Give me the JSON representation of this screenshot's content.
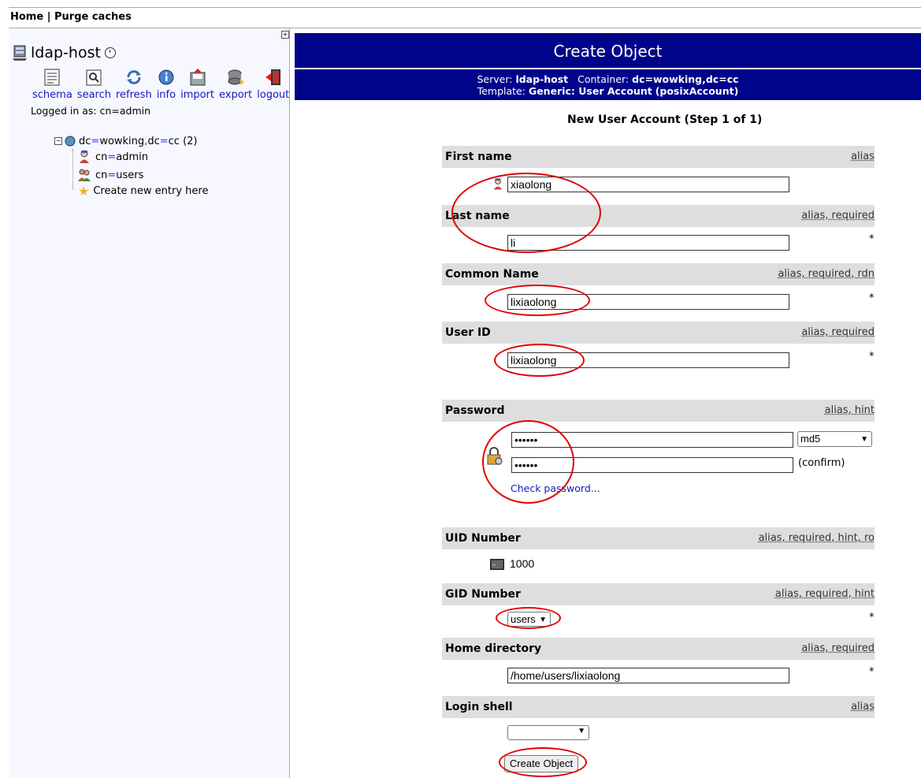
{
  "nav": {
    "home": "Home",
    "separator": "|",
    "purge": "Purge caches"
  },
  "server": {
    "name": "ldap-host"
  },
  "toolbar": [
    "schema",
    "search",
    "refresh",
    "info",
    "import",
    "export",
    "logout"
  ],
  "logged_in": {
    "label": "Logged in as:",
    "cn": "cn",
    "eq": "=",
    "value": "admin"
  },
  "tree": {
    "root": {
      "dc1": "dc",
      "eq": "=",
      "v1": "wowking",
      "comma": ",",
      "dc2": "dc",
      "v2": "cc",
      "count": "(2)"
    },
    "children": [
      {
        "key": "cn",
        "value": "admin"
      },
      {
        "key": "cn",
        "value": "users"
      }
    ],
    "create": "Create new entry here"
  },
  "banner": {
    "title": "Create Object",
    "server_label": "Server:",
    "server_value": "ldap-host",
    "container_label": "Container:",
    "container_value": "dc=wowking,dc=cc",
    "template_label": "Template:",
    "template_value": "Generic: User Account",
    "template_class": "(posixAccount)"
  },
  "step_title": "New User Account (Step 1 of 1)",
  "fields": {
    "first_name": {
      "label": "First name",
      "hints": "alias",
      "value": "xiaolong"
    },
    "last_name": {
      "label": "Last name",
      "hints": "alias, required",
      "value": "li",
      "required": "*"
    },
    "common_name": {
      "label": "Common Name",
      "hints": "alias, required, rdn",
      "value": "lixiaolong",
      "required": "*"
    },
    "user_id": {
      "label": "User ID",
      "hints": "alias, required",
      "value": "lixiaolong",
      "required": "*"
    },
    "password": {
      "label": "Password",
      "hints": "alias, hint",
      "value": "••••••",
      "confirm_value": "••••••",
      "hash": "md5",
      "confirm_label": "(confirm)",
      "check_link": "Check password..."
    },
    "uid_number": {
      "label": "UID Number",
      "hints": "alias, required, hint, ro",
      "value": "1000"
    },
    "gid_number": {
      "label": "GID Number",
      "hints": "alias, required, hint",
      "value": "users",
      "required": "*"
    },
    "home_dir": {
      "label": "Home directory",
      "hints": "alias, required",
      "value": "/home/users/lixiaolong",
      "required": "*"
    },
    "login_shell": {
      "label": "Login shell",
      "hints": "alias",
      "value": ""
    }
  },
  "submit": "Create Object",
  "colors": {
    "banner": "#00048a",
    "link": "#1515c0",
    "annotation": "#e00000",
    "header_bg": "#dedede"
  }
}
